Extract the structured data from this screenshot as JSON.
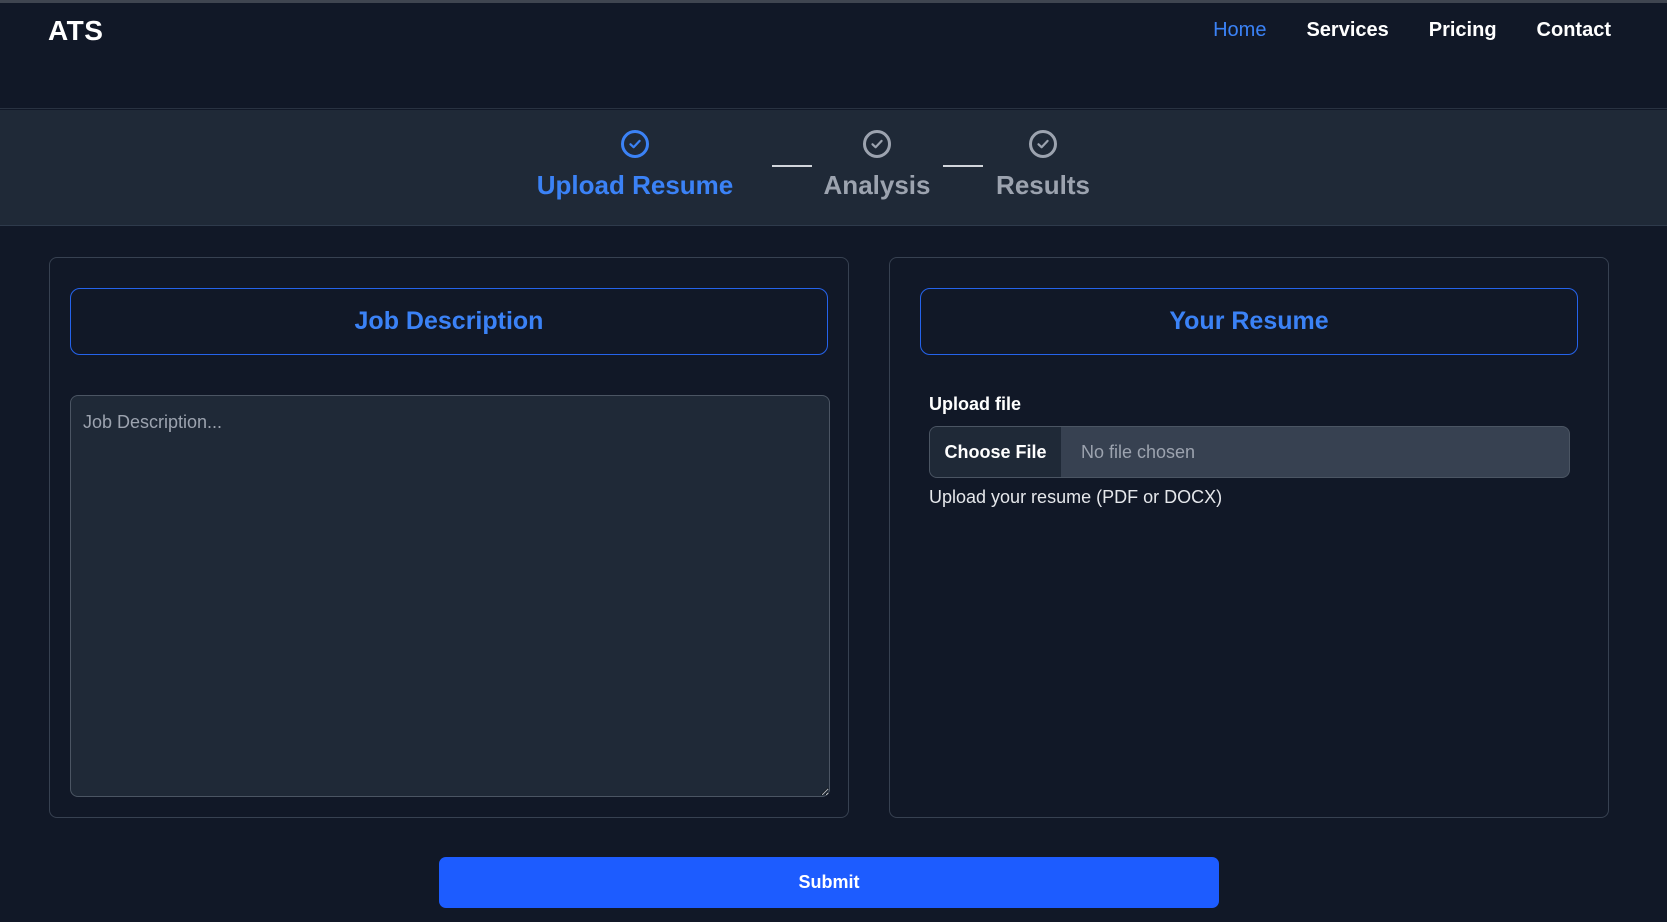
{
  "navbar": {
    "brand": "ATS",
    "links": [
      {
        "label": "Home",
        "active": true
      },
      {
        "label": "Services",
        "active": false
      },
      {
        "label": "Pricing",
        "active": false
      },
      {
        "label": "Contact",
        "active": false
      }
    ]
  },
  "steps": [
    {
      "label": "Upload Resume",
      "icon": "check-circle-icon",
      "active": true
    },
    {
      "label": "Analysis",
      "icon": "check-circle-icon",
      "active": false
    },
    {
      "label": "Results",
      "icon": "check-circle-icon",
      "active": false
    }
  ],
  "job_panel": {
    "title": "Job Description",
    "textarea_placeholder": "Job Description...",
    "textarea_value": ""
  },
  "resume_panel": {
    "title": "Your Resume",
    "upload_label": "Upload file",
    "choose_button": "Choose File",
    "file_status": "No file chosen",
    "help_text": "Upload your resume (PDF or DOCX)"
  },
  "submit_label": "Submit",
  "colors": {
    "background": "#111827",
    "accent": "#3b82f6",
    "submit": "#1d5cff",
    "muted": "#9ca3af"
  }
}
